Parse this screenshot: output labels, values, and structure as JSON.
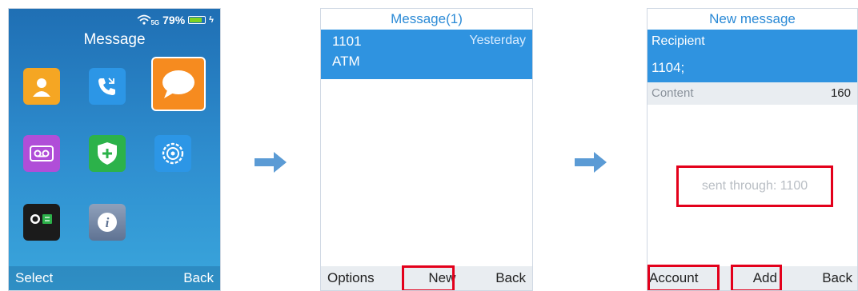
{
  "screen1": {
    "status_signal": "5G",
    "status_battery": "79%",
    "title": "Message",
    "apps": [
      {
        "icon": "contacts-icon",
        "color": "#f5a623"
      },
      {
        "icon": "call-history-icon",
        "color": "#2c96e6"
      },
      {
        "icon": "message-icon",
        "color": "#f68b1f"
      },
      {
        "icon": "voicemail-icon",
        "color": "#b04ed8"
      },
      {
        "icon": "security-icon",
        "color": "#2cb24a"
      },
      {
        "icon": "settings-icon",
        "color": "#2c96e6"
      },
      {
        "icon": "tools-icon",
        "color": "#1b1b1b"
      },
      {
        "icon": "info-icon",
        "color": "#7a8ca6"
      }
    ],
    "softkey_left": "Select",
    "softkey_right": "Back"
  },
  "screen2": {
    "title": "Message(1)",
    "message": {
      "number": "1101",
      "time": "Yesterday",
      "preview": "ATM"
    },
    "softkey_left": "Options",
    "softkey_center": "New",
    "softkey_right": "Back"
  },
  "screen3": {
    "title": "New message",
    "recipient_label": "Recipient",
    "recipient_value": "1104;",
    "content_label": "Content",
    "content_count": "160",
    "sent_through": "sent through: 1100",
    "softkey_left": "Account",
    "softkey_center": "Add",
    "softkey_right": "Back"
  },
  "colors": {
    "accent_blue": "#2f93e0",
    "highlight_red": "#e3001b",
    "arrow_blue": "#5b9bd5"
  }
}
